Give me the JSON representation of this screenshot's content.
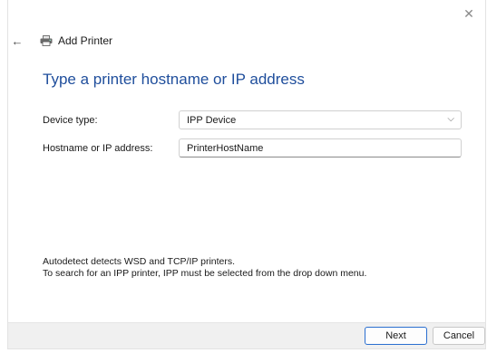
{
  "window": {
    "title": "Add Printer",
    "close_icon": "close-icon",
    "back_icon": "back-arrow-icon",
    "printer_icon": "printer-icon"
  },
  "page": {
    "heading": "Type a printer hostname or IP address"
  },
  "form": {
    "device_type_label": "Device type:",
    "device_type_value": "IPP Device",
    "hostname_label": "Hostname or IP address:",
    "hostname_value": "PrinterHostName"
  },
  "info": {
    "line1": "Autodetect detects WSD and TCP/IP printers.",
    "line2": "To search for an IPP printer, IPP must be selected from the drop down menu."
  },
  "footer": {
    "next_label": "Next",
    "cancel_label": "Cancel"
  },
  "colors": {
    "heading": "#1f4e9c",
    "primary_button_border": "#2b6fd0",
    "footer_background": "#f0f0f0"
  }
}
